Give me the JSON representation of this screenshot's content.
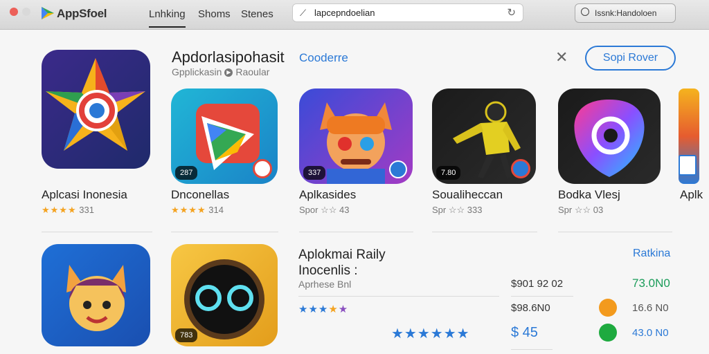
{
  "window": {
    "app_name": "AppSfoel",
    "tabs": [
      "Lnhking",
      "Shoms",
      "Stenes"
    ],
    "search_value": "lapcepndoelian",
    "header_button": "Issnk:Handoloen"
  },
  "section": {
    "title": "Apdorlasipohasit",
    "link": "Cooderre",
    "subtitle_prefix": "Gpplickasin",
    "subtitle_suffix": "Raoular",
    "sponsor_button": "Sopi Rover"
  },
  "apps_row1": [
    {
      "name": "Aplcasi Inonesia",
      "stars": "★★★★",
      "rating": "331",
      "badge": ""
    },
    {
      "name": "Dnconellas",
      "stars": "★★★★",
      "rating": "314",
      "badge": "287"
    },
    {
      "name": "Aplkasides",
      "stars": "",
      "rating": "Spor ☆☆ 43",
      "badge": "337"
    },
    {
      "name": "Soualiheccan",
      "stars": "",
      "rating": "Spr ☆☆ 333",
      "badge": "7.80"
    },
    {
      "name": "Bodka Vlesj",
      "stars": "",
      "rating": "Spr ☆☆ 03",
      "badge": ""
    },
    {
      "name": "Aplk",
      "stars": "",
      "rating": "",
      "badge": ""
    }
  ],
  "apps_row2": [
    {
      "badge": ""
    },
    {
      "badge": "783"
    }
  ],
  "promo": {
    "title_line1": "Aplokmai Raily",
    "title_line2": "Inocenlis :",
    "subtitle": "Aprhese Bnl",
    "stars_a": "★★★",
    "stars_b": "★",
    "stars_c": "★★★★★★",
    "prices": [
      "$901 92 02",
      "$98.6N0",
      "$ 45"
    ],
    "rank_header": "Ratkina",
    "rank_values": [
      "73.0N0",
      "16.6 N0",
      "43.0 N0"
    ]
  },
  "colors": {
    "accent": "#2b79d6",
    "star": "#f4a321",
    "rank_green": "#1b9c5a",
    "rank_dark": "#555555",
    "rank_blue": "#2b79d6",
    "orange_dot": "#f39a1d",
    "green_dot": "#1eaa3f"
  }
}
